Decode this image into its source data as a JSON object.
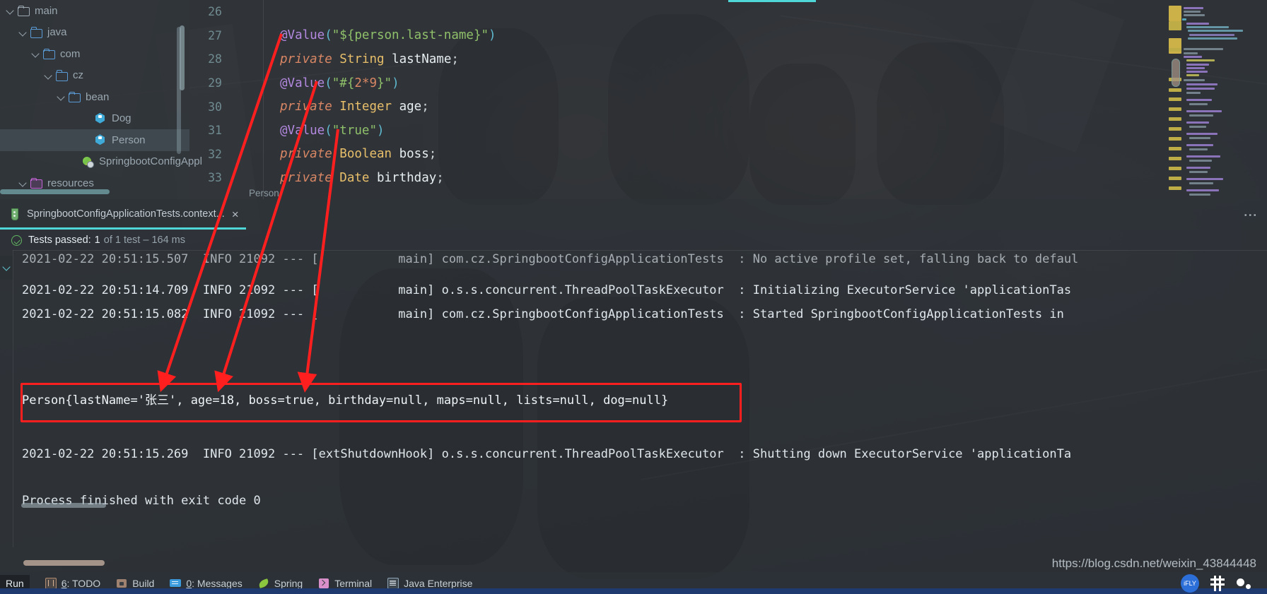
{
  "project_tree": {
    "items": [
      {
        "label": "main",
        "icon": "folder-icon",
        "indent": 0,
        "expanded": true,
        "selected": false
      },
      {
        "label": "java",
        "icon": "folder-blue-icon",
        "indent": 1,
        "expanded": true,
        "selected": false
      },
      {
        "label": "com",
        "icon": "folder-blue-icon",
        "indent": 2,
        "expanded": true,
        "selected": false
      },
      {
        "label": "cz",
        "icon": "folder-blue-icon",
        "indent": 3,
        "expanded": true,
        "selected": false
      },
      {
        "label": "bean",
        "icon": "folder-blue-icon",
        "indent": 4,
        "expanded": true,
        "selected": false
      },
      {
        "label": "Dog",
        "icon": "java-class-icon",
        "indent": 6,
        "expanded": false,
        "selected": false
      },
      {
        "label": "Person",
        "icon": "java-class-icon",
        "indent": 6,
        "expanded": false,
        "selected": true
      },
      {
        "label": "SpringbootConfigAppl",
        "icon": "spring-app-icon",
        "indent": 5,
        "expanded": false,
        "selected": false
      },
      {
        "label": "resources",
        "icon": "folder-purple-icon",
        "indent": 1,
        "expanded": true,
        "selected": false
      }
    ]
  },
  "editor": {
    "breadcrumb": "Person",
    "lines": [
      {
        "no": "26",
        "tokens": []
      },
      {
        "no": "27",
        "tokens": [
          {
            "t": "@Value",
            "c": "tk-ann"
          },
          {
            "t": "(",
            "c": "tk-paren"
          },
          {
            "t": "\"${person.last-name}\"",
            "c": "tk-str"
          },
          {
            "t": ")",
            "c": "tk-paren"
          }
        ]
      },
      {
        "no": "28",
        "tokens": [
          {
            "t": "private ",
            "c": "tk-kw"
          },
          {
            "t": "String ",
            "c": "tk-type"
          },
          {
            "t": "lastName",
            "c": "tk-var"
          },
          {
            "t": ";",
            "c": "tk-brace"
          }
        ]
      },
      {
        "no": "29",
        "tokens": [
          {
            "t": "@Value",
            "c": "tk-ann"
          },
          {
            "t": "(",
            "c": "tk-paren"
          },
          {
            "t": "\"#{",
            "c": "tk-str"
          },
          {
            "t": "2*9",
            "c": "tk-num"
          },
          {
            "t": "}\"",
            "c": "tk-str"
          },
          {
            "t": ")",
            "c": "tk-paren"
          }
        ]
      },
      {
        "no": "30",
        "tokens": [
          {
            "t": "private ",
            "c": "tk-kw"
          },
          {
            "t": "Integer ",
            "c": "tk-type"
          },
          {
            "t": "age",
            "c": "tk-var"
          },
          {
            "t": ";",
            "c": "tk-brace"
          }
        ]
      },
      {
        "no": "31",
        "tokens": [
          {
            "t": "@Value",
            "c": "tk-ann"
          },
          {
            "t": "(",
            "c": "tk-paren"
          },
          {
            "t": "\"true\"",
            "c": "tk-str"
          },
          {
            "t": ")",
            "c": "tk-paren"
          }
        ]
      },
      {
        "no": "32",
        "tokens": [
          {
            "t": "private ",
            "c": "tk-kw"
          },
          {
            "t": "Boolean ",
            "c": "tk-type"
          },
          {
            "t": "boss",
            "c": "tk-var"
          },
          {
            "t": ";",
            "c": "tk-brace"
          }
        ]
      },
      {
        "no": "33",
        "tokens": [
          {
            "t": "private ",
            "c": "tk-kw"
          },
          {
            "t": "Date ",
            "c": "tk-type"
          },
          {
            "t": "birthday",
            "c": "tk-var"
          },
          {
            "t": ";",
            "c": "tk-brace"
          }
        ]
      }
    ]
  },
  "run_panel": {
    "tab_label": "SpringbootConfigApplicationTests.context...",
    "tab_close": "×",
    "tab_icon": "test-tube-icon",
    "more_menu": "⋮",
    "test_status": {
      "icon": "green-check-circle-icon",
      "passed_label": "Tests passed:",
      "count": "1",
      "detail": "of 1 test – 164 ms"
    },
    "console_lines": [
      {
        "text": "2021-02-22 20:51:15.507  INFO 21092 --- [           main] com.cz.SpringbootConfigApplicationTests  : No active profile set, falling back to defaul",
        "clipped": true
      },
      {
        "text": "2021-02-22 20:51:14.709  INFO 21092 --- [           main] o.s.s.concurrent.ThreadPoolTaskExecutor  : Initializing ExecutorService 'applicationTas",
        "clipped": false
      },
      {
        "text": "2021-02-22 20:51:15.082  INFO 21092 --- [           main] com.cz.SpringbootConfigApplicationTests  : Started SpringbootConfigApplicationTests in ",
        "clipped": false
      }
    ],
    "person_output": "Person{lastName='张三', age=18, boss=true, birthday=null, maps=null, lists=null, dog=null}",
    "shutdown_line": "2021-02-22 20:51:15.269  INFO 21092 --- [extShutdownHook] o.s.s.concurrent.ThreadPoolTaskExecutor  : Shutting down ExecutorService 'applicationTa",
    "process_line": "Process finished with exit code 0",
    "highlight_color": "#ff1f1f"
  },
  "statusbar": {
    "run_label": "Run",
    "items": [
      {
        "label": "6: TODO",
        "mnemonic": "6",
        "icon": "todo-icon"
      },
      {
        "label": "Build",
        "mnemonic": "",
        "icon": "build-icon"
      },
      {
        "label": "0: Messages",
        "mnemonic": "0",
        "icon": "messages-icon"
      },
      {
        "label": "Spring",
        "mnemonic": "",
        "icon": "spring-leaf-icon"
      },
      {
        "label": "Terminal",
        "mnemonic": "",
        "icon": "terminal-icon"
      },
      {
        "label": "Java Enterprise",
        "mnemonic": "",
        "icon": "java-enterprise-icon"
      }
    ]
  },
  "watermark": "https://blog.csdn.net/weixin_43844448",
  "tray": {
    "ifly": "iFLY"
  }
}
